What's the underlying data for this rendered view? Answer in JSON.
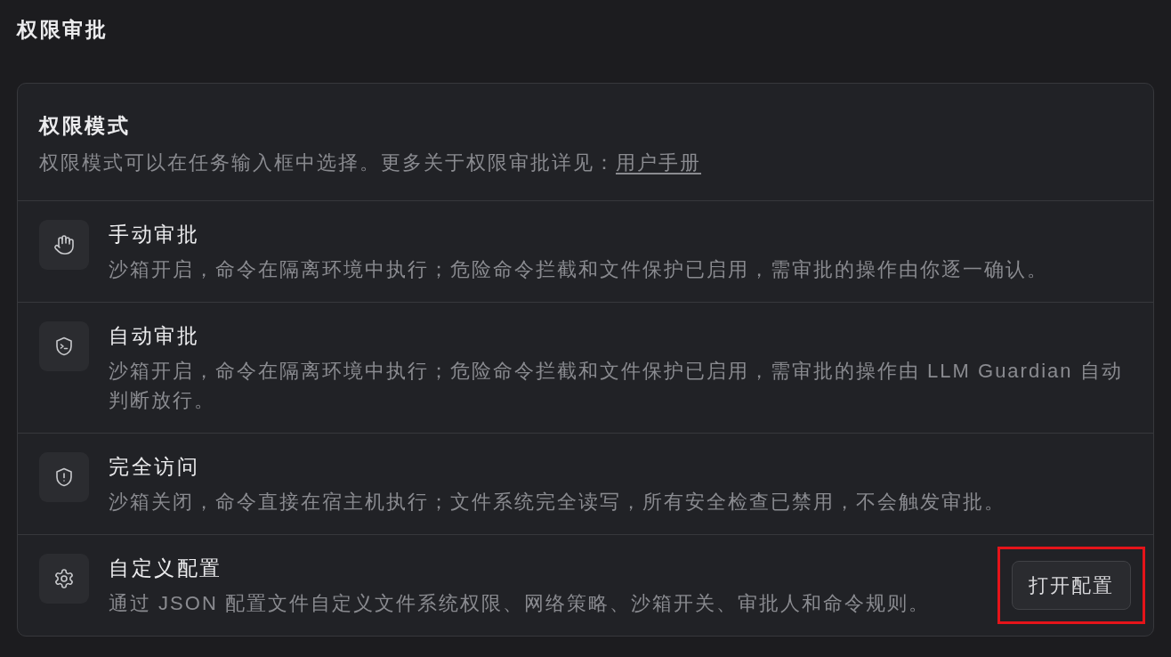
{
  "section_title": "权限审批",
  "card": {
    "title": "权限模式",
    "description": "权限模式可以在任务输入框中选择。更多关于权限审批详见：",
    "link": "用户手册"
  },
  "modes": [
    {
      "kind": "manual",
      "title": "手动审批",
      "description": "沙箱开启，命令在隔离环境中执行；危险命令拦截和文件保护已启用，需审批的操作由你逐一确认。"
    },
    {
      "kind": "auto",
      "title": "自动审批",
      "description": "沙箱开启，命令在隔离环境中执行；危险命令拦截和文件保护已启用，需审批的操作由 LLM Guardian 自动判断放行。"
    },
    {
      "kind": "full_access",
      "title": "完全访问",
      "description": "沙箱关闭，命令直接在宿主机执行；文件系统完全读写，所有安全检查已禁用，不会触发审批。"
    },
    {
      "kind": "custom",
      "title": "自定义配置",
      "description": "通过 JSON 配置文件自定义文件系统权限、网络策略、沙箱开关、审批人和命令规则。",
      "button": {
        "label": "打开配置",
        "highlighted": true
      }
    }
  ]
}
